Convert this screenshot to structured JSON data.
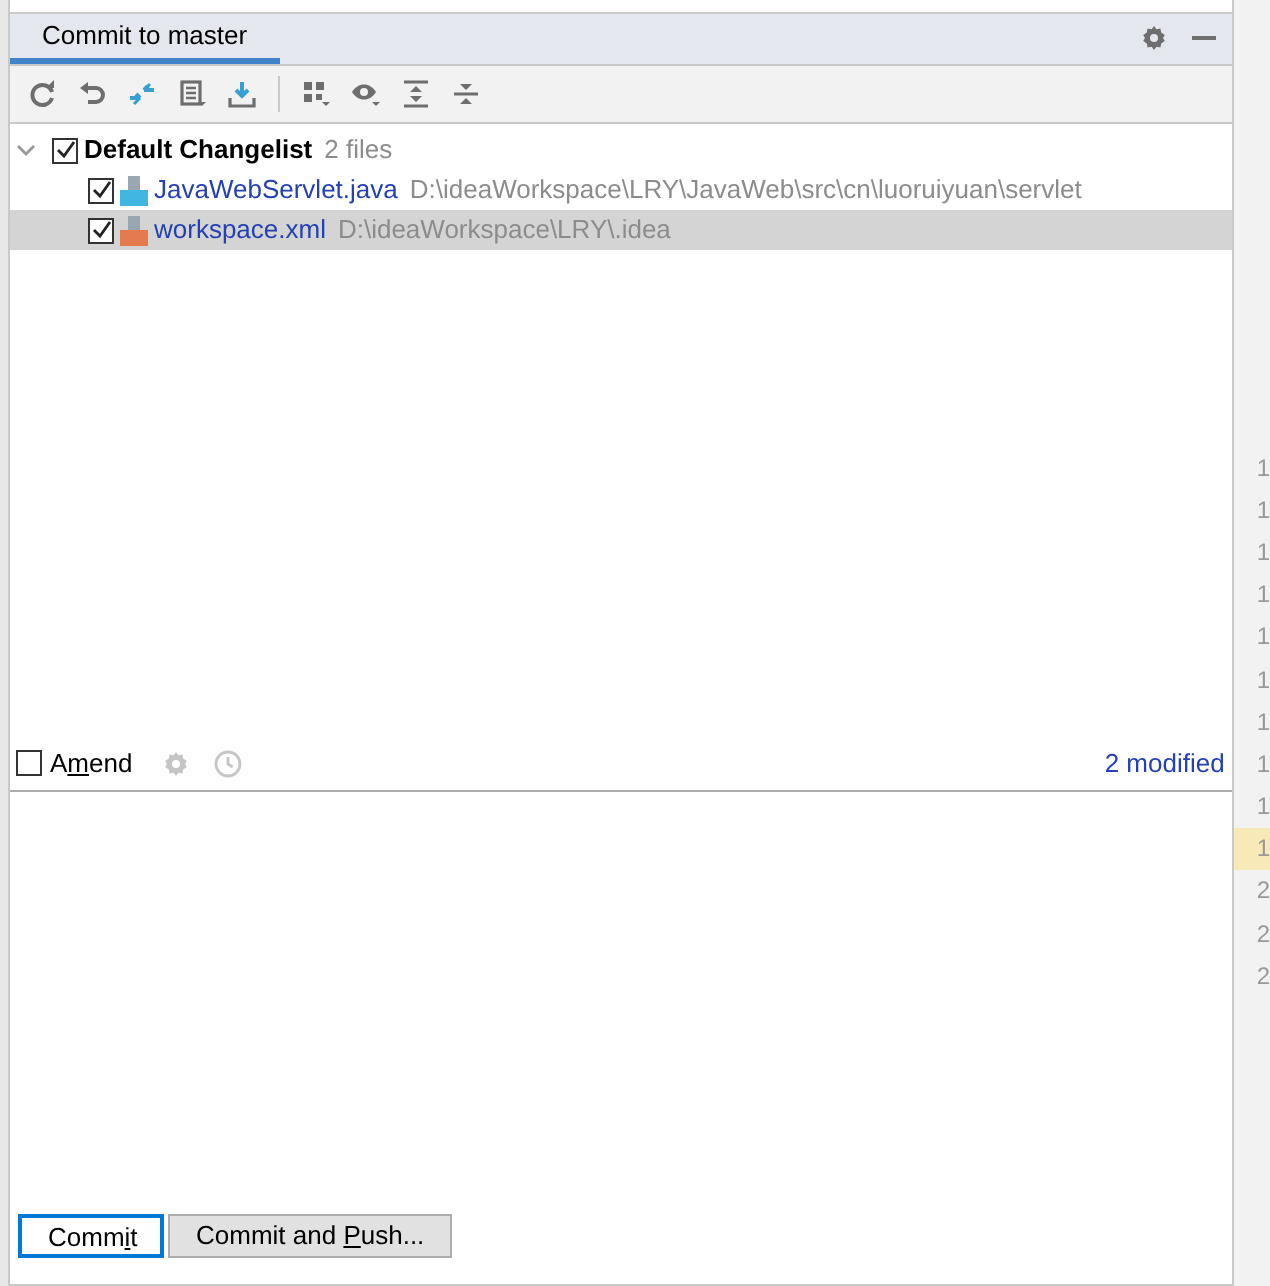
{
  "tab": {
    "label": "Commit to master",
    "selected": true
  },
  "toolbar": [
    {
      "kind": "refresh"
    },
    {
      "kind": "rollback"
    },
    {
      "kind": "diff"
    },
    {
      "kind": "changelist"
    },
    {
      "kind": "shelve"
    },
    {
      "kind": "sep"
    },
    {
      "kind": "group"
    },
    {
      "kind": "view"
    },
    {
      "kind": "expand"
    },
    {
      "kind": "collapse"
    }
  ],
  "changelist": {
    "name": "Default Changelist",
    "count": "2 files",
    "expanded": true,
    "checked": true,
    "children": [
      {
        "name": "JavaWebServlet.java",
        "path": "D:\\ideaWorkspace\\LRY\\JavaWeb\\src\\cn\\luoruiyuan\\servlet",
        "kind": "java",
        "checked": true,
        "selected": false
      },
      {
        "name": "workspace.xml",
        "path": "D:\\ideaWorkspace\\LRY\\.idea",
        "kind": "xml",
        "checked": true,
        "selected": true
      }
    ]
  },
  "amend": {
    "label_parts": [
      "A",
      "m",
      "end"
    ],
    "checked": false
  },
  "modified": "2 modified",
  "gutter": [
    {
      "text": "1",
      "highlighted": false
    },
    {
      "text": "1",
      "highlighted": false
    },
    {
      "text": "1",
      "highlighted": false
    },
    {
      "text": "1",
      "highlighted": false
    },
    {
      "text": "1",
      "highlighted": false
    },
    {
      "text": "1",
      "highlighted": false
    },
    {
      "text": "1",
      "highlighted": false
    },
    {
      "text": "1",
      "highlighted": false
    },
    {
      "text": "1",
      "highlighted": false
    },
    {
      "text": "1",
      "highlighted": true
    },
    {
      "text": "2",
      "highlighted": false
    },
    {
      "text": "2",
      "highlighted": false
    },
    {
      "text": "2",
      "highlighted": false
    }
  ],
  "buttons": [
    {
      "label_parts": [
        "Comm",
        "i",
        "t"
      ],
      "default": true
    },
    {
      "label_parts": [
        "Commit and ",
        "P",
        "ush..."
      ],
      "default": false
    }
  ]
}
